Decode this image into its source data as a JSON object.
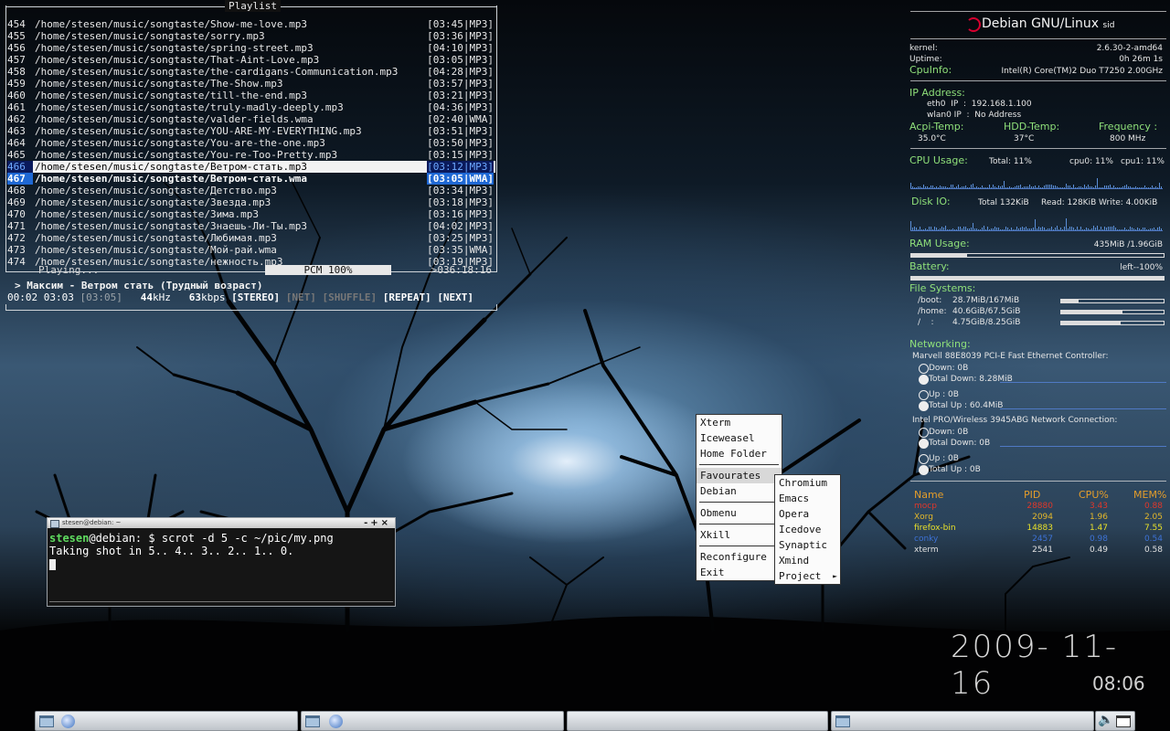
{
  "playlist": {
    "title": "Playlist",
    "rows": [
      {
        "num": "454",
        "path": "/home/stesen/music/songtaste/Show-me-love.mp3",
        "dur": "[03:45|MP3]"
      },
      {
        "num": "455",
        "path": "/home/stesen/music/songtaste/sorry.mp3",
        "dur": "[03:36|MP3]"
      },
      {
        "num": "456",
        "path": "/home/stesen/music/songtaste/spring-street.mp3",
        "dur": "[04:10|MP3]"
      },
      {
        "num": "457",
        "path": "/home/stesen/music/songtaste/That-Aint-Love.mp3",
        "dur": "[03:05|MP3]"
      },
      {
        "num": "458",
        "path": "/home/stesen/music/songtaste/the-cardigans-Communication.mp3",
        "dur": "[04:28|MP3]"
      },
      {
        "num": "459",
        "path": "/home/stesen/music/songtaste/The-Show.mp3",
        "dur": "[03:57|MP3]"
      },
      {
        "num": "460",
        "path": "/home/stesen/music/songtaste/till-the-end.mp3",
        "dur": "[03:21|MP3]"
      },
      {
        "num": "461",
        "path": "/home/stesen/music/songtaste/truly-madly-deeply.mp3",
        "dur": "[04:36|MP3]"
      },
      {
        "num": "462",
        "path": "/home/stesen/music/songtaste/valder-fields.wma",
        "dur": "[02:40|WMA]"
      },
      {
        "num": "463",
        "path": "/home/stesen/music/songtaste/YOU-ARE-MY-EVERYTHING.mp3",
        "dur": "[03:51|MP3]"
      },
      {
        "num": "464",
        "path": "/home/stesen/music/songtaste/You-are-the-one.mp3",
        "dur": "[03:50|MP3]"
      },
      {
        "num": "465",
        "path": "/home/stesen/music/songtaste/You-re-Too-Pretty.mp3",
        "dur": "[03:15|MP3]"
      },
      {
        "num": "466",
        "path": "/home/stesen/music/songtaste/Ветром-стать.mp3",
        "dur": "[03:12|MP3]",
        "state": "sel"
      },
      {
        "num": "467",
        "path": "/home/stesen/music/songtaste/Ветром-стать.wma",
        "dur": "[03:05|WMA]",
        "state": "cur"
      },
      {
        "num": "468",
        "path": "/home/stesen/music/songtaste/Детство.mp3",
        "dur": "[03:34|MP3]"
      },
      {
        "num": "469",
        "path": "/home/stesen/music/songtaste/Звезда.mp3",
        "dur": "[03:18|MP3]"
      },
      {
        "num": "470",
        "path": "/home/stesen/music/songtaste/Зима.mp3",
        "dur": "[03:16|MP3]"
      },
      {
        "num": "471",
        "path": "/home/stesen/music/songtaste/Знаешь-Ли-Ты.mp3",
        "dur": "[04:02|MP3]"
      },
      {
        "num": "472",
        "path": "/home/stesen/music/songtaste/Любимая.mp3",
        "dur": "[03:25|MP3]"
      },
      {
        "num": "473",
        "path": "/home/stesen/music/songtaste/Мой-рай.wma",
        "dur": "[03:35|WMA]"
      },
      {
        "num": "474",
        "path": "/home/stesen/music/songtaste/нежность.mp3",
        "dur": "[03:19|MP3]"
      }
    ],
    "status": "Playing...",
    "pcm": "PCM 100%",
    "remaining": ">036:18:16",
    "now_playing": "> Максим - Ветром стать (Трудный возраст)",
    "elapsed": "00:02",
    "remain_time": "03:03",
    "total": "[03:05]",
    "khz": "44",
    "khz_unit": "kHz",
    "kbps": "63",
    "kbps_unit": "kbps",
    "stereo": "[STEREO]",
    "net": "[NET]",
    "shuffle": "[SHUFFLE]",
    "repeat": "[REPEAT]",
    "next": "[NEXT]"
  },
  "conky": {
    "title": "Debian GNU/Linux",
    "title_sub": "sid",
    "kernel_label": "kernel:",
    "kernel": "2.6.30-2-amd64",
    "uptime_label": "Uptime:",
    "uptime": "0h 26m 1s",
    "cpuinfo_label": "CpuInfo:",
    "cpuinfo": "Intel(R) Core(TM)2 Duo T7250 2.00GHz",
    "ip_head": "IP Address:",
    "eth0": "eth0  IP  :  192.168.1.100",
    "wlan0": "wlan0 IP  :  No Address",
    "acpi_head": "Acpi-Temp:",
    "acpi": "35.0°C",
    "hdd_head": "HDD-Temp:",
    "hdd": "37°C",
    "freq_head": "Frequency :",
    "freq": "800 MHz",
    "cpu_head": "CPU Usage:",
    "cpu_total": "Total: 11%",
    "cpu0": "cpu0: 11%",
    "cpu1": "cpu1: 11%",
    "disk_head": "Disk IO:",
    "disk_total": "Total 132KiB",
    "disk_read": "Read: 128KiB",
    "disk_write": "Write: 4.00KiB",
    "ram_head": "RAM Usage:",
    "ram": "435MiB /1.96GiB",
    "battery_head": "Battery:",
    "battery": "left--100%",
    "fs_head": "File Systems:",
    "fs": [
      {
        "mount": "/boot:",
        "size": "28.7MiB/167MiB",
        "used": 0.17
      },
      {
        "mount": "/home:",
        "size": "40.6GiB/67.5GiB",
        "used": 0.6
      },
      {
        "mount": "/    :",
        "size": "4.75GiB/8.25GiB",
        "used": 0.58
      }
    ],
    "net_head": "Networking:",
    "eth_name": "Marvell 88E8039 PCI-E Fast Ethernet Controller:",
    "eth_down": "Down:  0B",
    "eth_total_down": "Total Down: 8.28MiB",
    "eth_up": "Up  :  0B",
    "eth_total_up": "Total Up  : 60.4MiB",
    "wifi_name": "Intel PRO/Wireless 3945ABG Network Connection:",
    "wifi_down": "Down:  0B",
    "wifi_total_down": "Total Down: 0B",
    "wifi_up": "Up  :  0B",
    "wifi_total_up": "Total Up  : 0B",
    "proc_hdr": {
      "name": "Name",
      "pid": "PID",
      "cpu": "CPU%",
      "mem": "MEM%"
    },
    "procs": [
      {
        "name": "mocp",
        "pid": "28880",
        "cpu": "3.43",
        "mem": "0.88",
        "color": "#e0372a"
      },
      {
        "name": "Xorg",
        "pid": "2094",
        "cpu": "1.96",
        "mem": "2.05",
        "color": "#e4b82a"
      },
      {
        "name": "firefox-bin",
        "pid": "14883",
        "cpu": "1.47",
        "mem": "7.55",
        "color": "#e8e02a"
      },
      {
        "name": "conky",
        "pid": "2457",
        "cpu": "0.98",
        "mem": "0.54",
        "color": "#3d72d6"
      },
      {
        "name": "xterm",
        "pid": "2541",
        "cpu": "0.49",
        "mem": "0.58",
        "color": "#e0e0e0"
      }
    ]
  },
  "clock": {
    "date": "2009- 11- 16",
    "time": "08:06"
  },
  "terminal": {
    "title": "stesen@debian: ~",
    "user": "stesen",
    "host_prompt": "@debian: $ ",
    "command": "scrot -d 5 -c ~/pic/my.png",
    "output": "Taking shot in 5.. 4.. 3.. 2.. 1.. 0.",
    "buttons": "-+×"
  },
  "menu": {
    "items": [
      "Xterm",
      "Iceweasel",
      "Home Folder"
    ],
    "favourites": "Favourates",
    "debian": "Debian",
    "obmenu": "Obmenu",
    "xkill": "Xkill",
    "reconfigure": "Reconfigure",
    "exit": "Exit"
  },
  "submenu": {
    "items": [
      "Chromium",
      "Emacs",
      "Opera",
      "Icedove",
      "Synaptic",
      "Xmind",
      "Project"
    ]
  }
}
